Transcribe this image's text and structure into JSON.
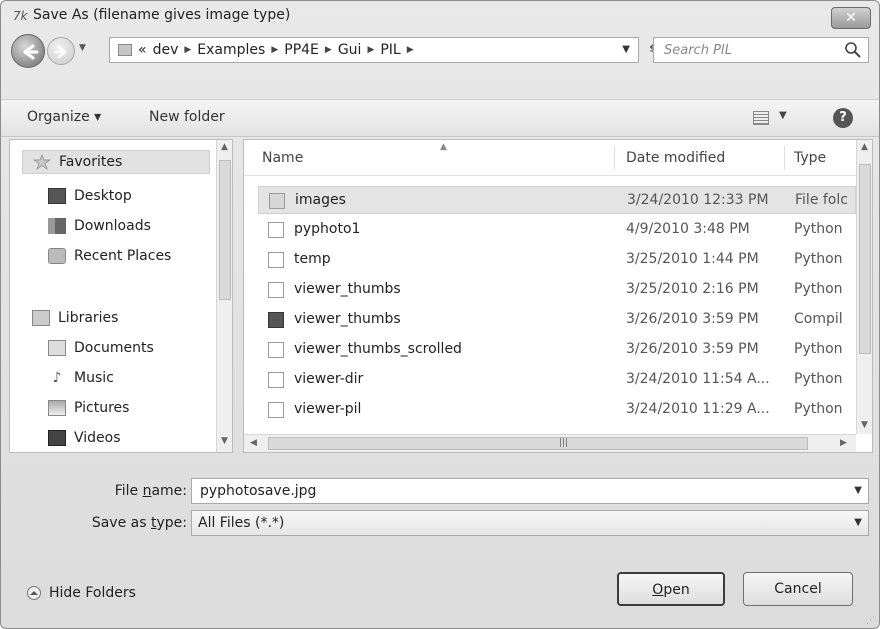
{
  "window": {
    "title": "Save As (filename gives image type)",
    "title_icon": "7k",
    "close": "✕"
  },
  "address": {
    "overflow": "«",
    "crumbs": [
      "dev",
      "Examples",
      "PP4E",
      "Gui",
      "PIL"
    ]
  },
  "search": {
    "placeholder": "Search PIL"
  },
  "toolbar": {
    "organize_label": "Organize ▾",
    "new_folder_label": "New folder"
  },
  "nav": {
    "items": [
      {
        "label": "Favorites",
        "icon": "star-icon"
      },
      {
        "label": "Desktop",
        "icon": "desktop-icon"
      },
      {
        "label": "Downloads",
        "icon": "downloads-icon"
      },
      {
        "label": "Recent Places",
        "icon": "recent-places-icon"
      },
      {
        "label": "Libraries",
        "icon": "libraries-icon"
      },
      {
        "label": "Documents",
        "icon": "documents-icon"
      },
      {
        "label": "Music",
        "icon": "music-icon"
      },
      {
        "label": "Pictures",
        "icon": "pictures-icon"
      },
      {
        "label": "Videos",
        "icon": "videos-icon"
      }
    ]
  },
  "files": {
    "columns": {
      "name": "Name",
      "date": "Date modified",
      "type": "Type"
    },
    "rows": [
      {
        "name": "images",
        "date": "3/24/2010 12:33 PM",
        "type": "File folc",
        "icon": "folder-icon"
      },
      {
        "name": "pyphoto1",
        "date": "4/9/2010 3:48 PM",
        "type": "Python",
        "icon": "python-file-icon"
      },
      {
        "name": "temp",
        "date": "3/25/2010 1:44 PM",
        "type": "Python",
        "icon": "python-file-icon"
      },
      {
        "name": "viewer_thumbs",
        "date": "3/25/2010 2:16 PM",
        "type": "Python",
        "icon": "python-file-icon"
      },
      {
        "name": "viewer_thumbs",
        "date": "3/26/2010 3:59 PM",
        "type": "Compil",
        "icon": "compiled-python-icon"
      },
      {
        "name": "viewer_thumbs_scrolled",
        "date": "3/26/2010 3:59 PM",
        "type": "Python",
        "icon": "python-file-icon"
      },
      {
        "name": "viewer-dir",
        "date": "3/24/2010 11:54 A...",
        "type": "Python",
        "icon": "python-file-icon"
      },
      {
        "name": "viewer-pil",
        "date": "3/24/2010 11:29 A...",
        "type": "Python",
        "icon": "python-file-icon"
      }
    ]
  },
  "form": {
    "filename_label_pre": "File ",
    "filename_label_key": "n",
    "filename_label_post": "ame:",
    "filename_value": "pyphotosave.jpg",
    "type_label_pre": "Save as ",
    "type_label_key": "t",
    "type_label_post": "ype:",
    "type_value": "All Files (*.*)"
  },
  "footer": {
    "hide_folders": "Hide Folders",
    "open_key": "O",
    "open_rest": "pen",
    "cancel": "Cancel"
  }
}
